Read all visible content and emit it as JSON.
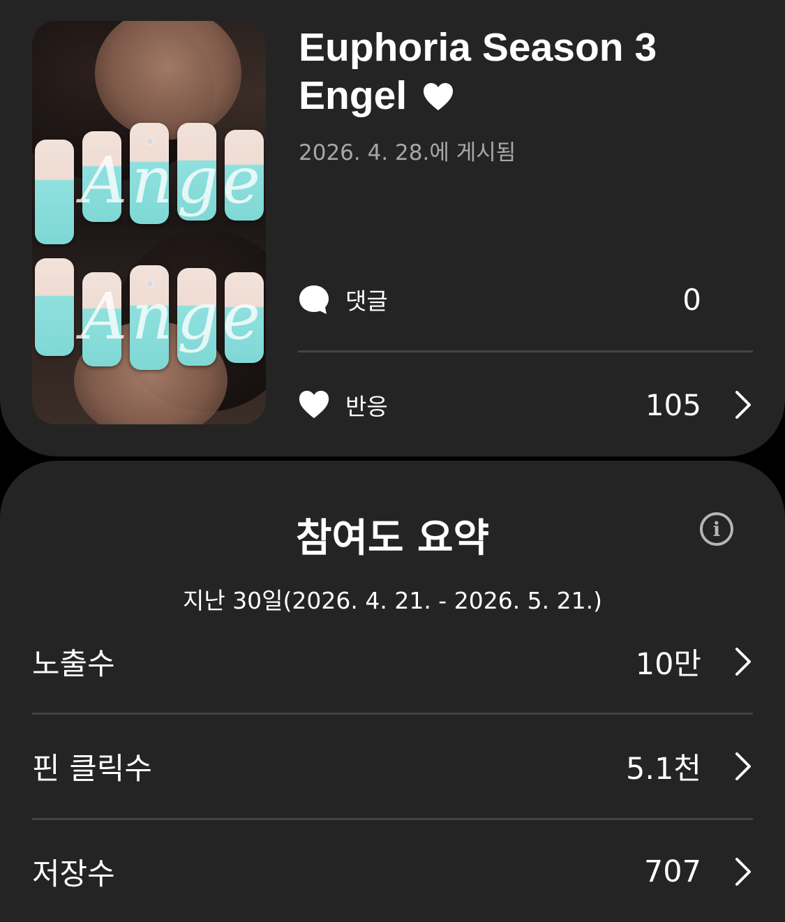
{
  "pin": {
    "title_line1": "Euphoria Season 3",
    "title_line2": "Engel",
    "title_emoji": "heart",
    "posted": "2026. 4. 28.에 게시됨",
    "thumbnail_alt": "nails-photo",
    "nail_script_text": "Angel"
  },
  "stats": {
    "comments": {
      "icon": "speech-bubble-icon",
      "label": "댓글",
      "value": "0"
    },
    "reactions": {
      "icon": "heart-icon",
      "label": "반응",
      "value": "105"
    }
  },
  "summary": {
    "title": "참여도 요약",
    "info_icon": "i",
    "period": "지난 30일(2026. 4. 21. - 2026. 5. 21.)",
    "metrics": [
      {
        "label": "노출수",
        "value": "10만"
      },
      {
        "label": "핀 클릭수",
        "value": "5.1천"
      },
      {
        "label": "저장수",
        "value": "707"
      }
    ]
  },
  "colors": {
    "background": "#000000",
    "card": "#242424",
    "divider": "#444444",
    "muted_text": "#a8a8a8",
    "nail_tip": "#8fe0de"
  }
}
